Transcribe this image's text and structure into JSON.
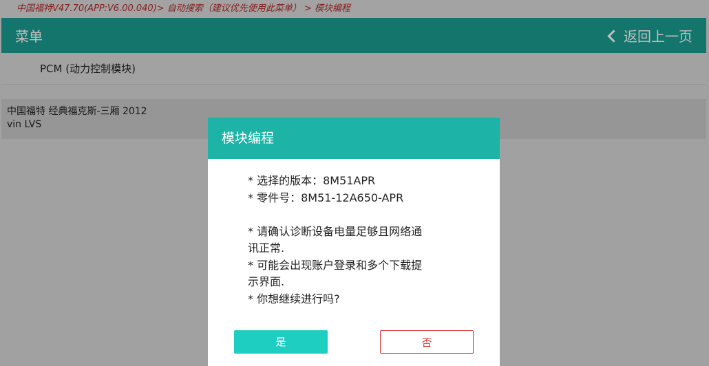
{
  "breadcrumb": "中国福特V47.70(APP:V6.00.040)> 自动搜索（建议优先使用此菜单） > 模块编程",
  "header": {
    "title": "菜单",
    "back_label": "返回上一页"
  },
  "menu": {
    "items": [
      {
        "label": "PCM (动力控制模块)"
      }
    ]
  },
  "vehicle": {
    "line1": "中国福特 经典福克斯-三厢 2012",
    "line2": "vin LVS"
  },
  "dialog": {
    "title": "模块编程",
    "lines": [
      "* 选择的版本：8M51APR",
      "* 零件号：8M51-12A650-APR",
      "",
      "* 请确认诊断设备电量足够且网络通",
      "讯正常.",
      "* 可能会出现账户登录和多个下载提",
      "示界面.",
      "* 你想继续进行吗?"
    ],
    "yes_label": "是",
    "no_label": "否"
  },
  "colors": {
    "header_bg": "#1a9c8f",
    "dialog_header_bg": "#1db3a6",
    "yes_button_bg": "#1ecec0",
    "no_button_color": "#dd3333",
    "breadcrumb_color": "#b22a2a"
  },
  "icons": {
    "back": "chevron-left-icon"
  }
}
